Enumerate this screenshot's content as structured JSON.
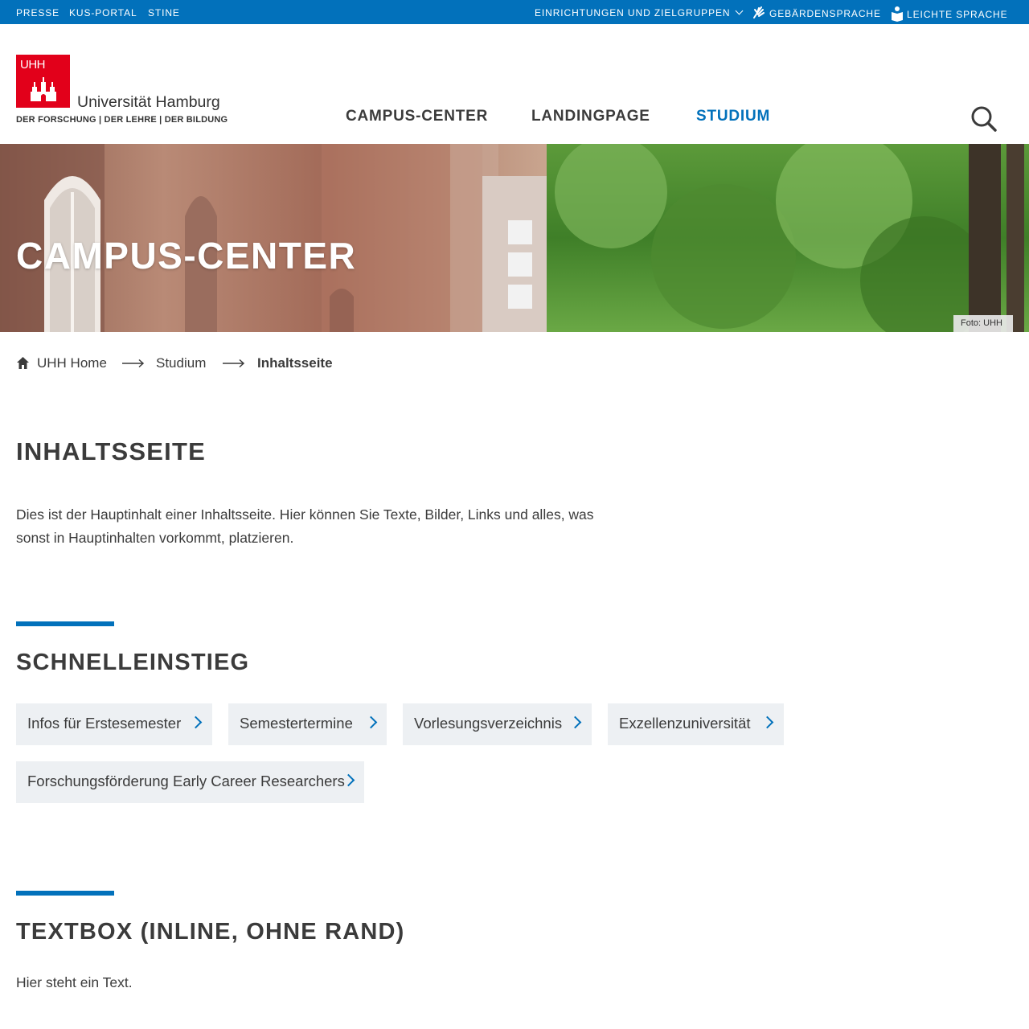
{
  "topbar": {
    "links": [
      "PRESSE",
      "KUS-PORTAL",
      "STINE"
    ],
    "einrichtungen": "EINRICHTUNGEN UND ZIELGRUPPEN",
    "gebaerdensprache": "GEBÄRDENSPRACHE",
    "leichte_sprache": "LEICHTE SPRACHE"
  },
  "logo": {
    "mark": "UHH",
    "name": "Universität Hamburg",
    "tagline": "DER FORSCHUNG | DER LEHRE | DER BILDUNG"
  },
  "mainnav": {
    "items": [
      "CAMPUS-CENTER",
      "LANDINGPAGE",
      "STUDIUM"
    ],
    "active": "STUDIUM"
  },
  "hero": {
    "title": "CAMPUS-CENTER",
    "credit": "Foto: UHH"
  },
  "breadcrumb": {
    "home": "UHH Home",
    "items": [
      "Studium"
    ],
    "current": "Inhaltsseite"
  },
  "content": {
    "title": "INHALTSSEITE",
    "intro": "Dies ist der Hauptinhalt einer Inhaltsseite. Hier können Sie Texte, Bilder, Links und alles, was sonst in Hauptinhalten vorkommt, platzieren."
  },
  "schnelleinstieg": {
    "title": "SCHNELLEINSTIEG",
    "links": [
      "Infos für Erstesemester",
      "Semestertermine",
      "Vorlesungsverzeichnis",
      "Exzellenzuniversität",
      "Forschungsförderung Early Career Researchers"
    ]
  },
  "textbox": {
    "title": "TEXTBOX (INLINE, OHNE RAND)",
    "text": "Hier steht ein Text."
  },
  "colors": {
    "brand_blue": "#0271bb",
    "brand_red": "#e2001a",
    "text": "#3b3b3b",
    "quick_bg": "#edf0f3"
  },
  "icons": [
    "hand-sign-icon",
    "easy-language-icon",
    "chevron-down-icon",
    "search-icon",
    "home-icon",
    "arrow-right-icon",
    "chevron-right-icon",
    "hamburg-castle-icon"
  ]
}
